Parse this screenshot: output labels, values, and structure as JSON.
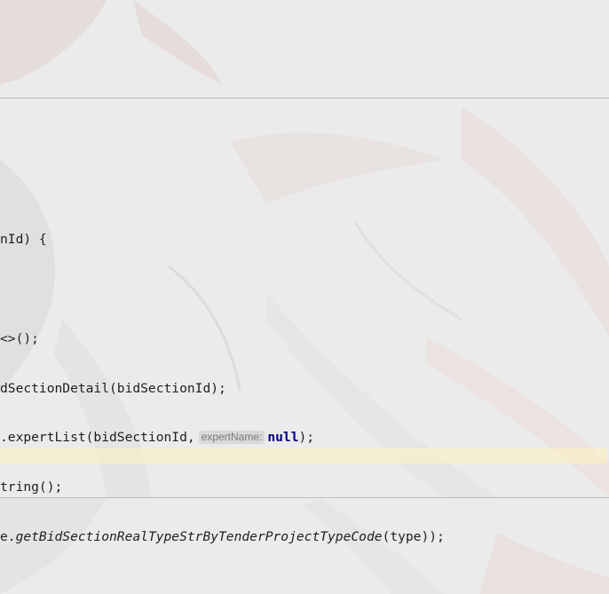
{
  "editor": {
    "lines": [
      {
        "text": "nId) {"
      },
      {
        "text": ""
      },
      {
        "text": "<>();"
      },
      {
        "text": "dSectionDetail(bidSectionId);"
      },
      {
        "prefix": ".expertList(bidSectionId,",
        "hint": "expertName:",
        "keyword": "null",
        "suffix": ");"
      },
      {
        "text": "tring();"
      },
      {
        "prefix": "e.",
        "static_method": "getBidSectionRealTypeStrByTenderProjectTypeCode",
        "suffix": "(type));"
      }
    ]
  },
  "colors": {
    "background": "#ebebeb",
    "divider": "#b9b9b9",
    "caret_line": "#fff4be",
    "keyword": "#000080",
    "text": "#1e1e1e",
    "hint_text": "#7b7b7b"
  }
}
